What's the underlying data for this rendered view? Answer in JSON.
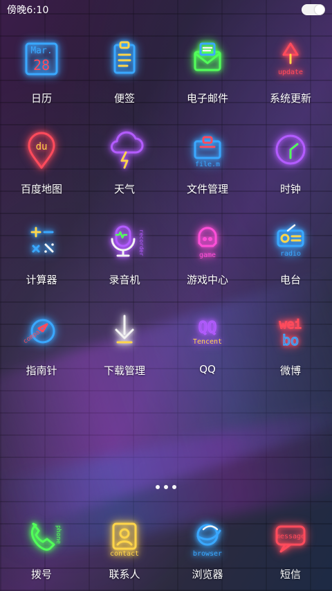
{
  "status": {
    "time": "傍晚6:10"
  },
  "apps": [
    {
      "label": "日历",
      "icon": "calendar-icon",
      "text1": "Mar.",
      "text2": "28"
    },
    {
      "label": "便签",
      "icon": "notes-icon"
    },
    {
      "label": "电子邮件",
      "icon": "mail-icon"
    },
    {
      "label": "系统更新",
      "icon": "update-icon",
      "text1": "update"
    },
    {
      "label": "百度地图",
      "icon": "map-pin-icon",
      "text1": "du"
    },
    {
      "label": "天气",
      "icon": "weather-icon"
    },
    {
      "label": "文件管理",
      "icon": "file-manager-icon",
      "text1": "file.m"
    },
    {
      "label": "时钟",
      "icon": "clock-icon"
    },
    {
      "label": "计算器",
      "icon": "calculator-icon"
    },
    {
      "label": "录音机",
      "icon": "recorder-icon",
      "text1": "recorder"
    },
    {
      "label": "游戏中心",
      "icon": "game-icon",
      "text1": "game"
    },
    {
      "label": "电台",
      "icon": "radio-icon",
      "text1": "radio"
    },
    {
      "label": "指南针",
      "icon": "compass-icon",
      "text1": "compass"
    },
    {
      "label": "下载管理",
      "icon": "download-icon"
    },
    {
      "label": "QQ",
      "icon": "qq-icon",
      "text1": "QQ",
      "text2": "Tencent"
    },
    {
      "label": "微博",
      "icon": "weibo-icon",
      "text1": "wei",
      "text2": "bo"
    }
  ],
  "dock": [
    {
      "label": "拨号",
      "icon": "phone-icon",
      "text1": "phone"
    },
    {
      "label": "联系人",
      "icon": "contact-icon",
      "text1": "contact"
    },
    {
      "label": "浏览器",
      "icon": "browser-icon",
      "text1": "browser"
    },
    {
      "label": "短信",
      "icon": "message-icon",
      "text1": "message"
    }
  ],
  "colors": {
    "neon_red": "#ff4b5c",
    "neon_yellow": "#ffd54a",
    "neon_green": "#52ff5a",
    "neon_blue": "#3aa8ff",
    "neon_purple": "#b35cff",
    "neon_pink": "#ff4fd8",
    "neon_white": "#f3f3f3"
  }
}
